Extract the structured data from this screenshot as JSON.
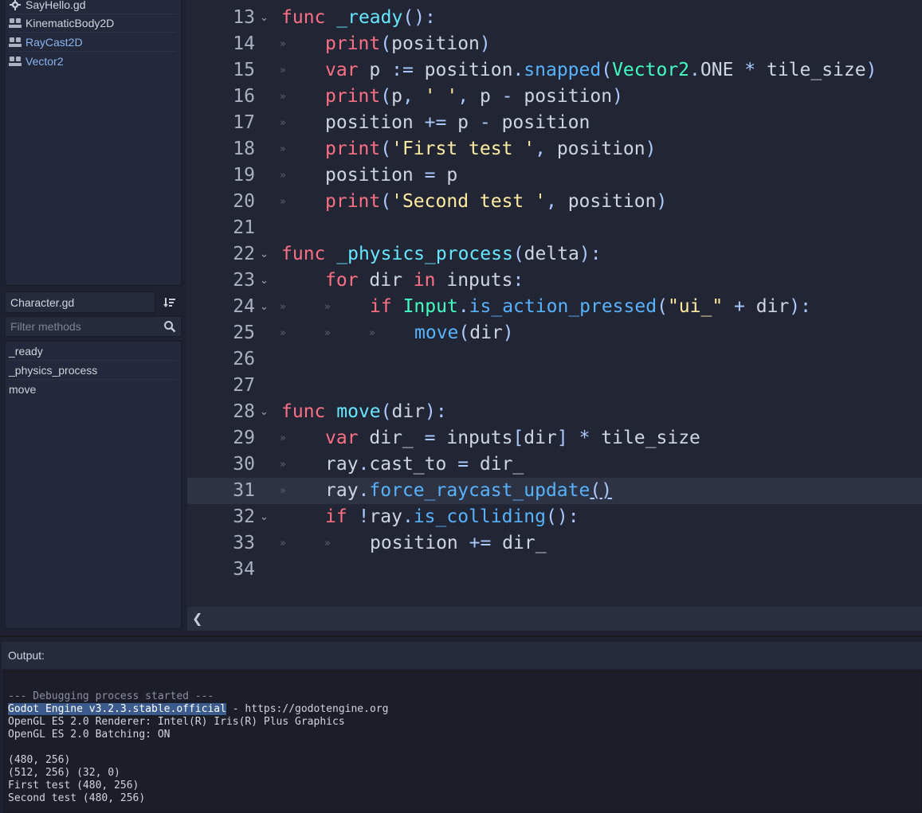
{
  "scripts_panel": {
    "items": [
      {
        "label": "SayHello.gd",
        "icon": "gear-icon"
      },
      {
        "label": "KinematicBody2D",
        "icon": "doc-icon"
      },
      {
        "label": "RayCast2D",
        "icon": "doc-icon"
      },
      {
        "label": "Vector2",
        "icon": "doc-icon"
      }
    ]
  },
  "methods_panel": {
    "file_name": "Character.gd",
    "filter_placeholder": "Filter methods",
    "methods": [
      "_ready",
      "_physics_process",
      "move"
    ]
  },
  "editor": {
    "lines": [
      {
        "n": "13",
        "fold": true,
        "indent": 0
      },
      {
        "n": "14",
        "fold": false,
        "indent": 1
      },
      {
        "n": "15",
        "fold": false,
        "indent": 1
      },
      {
        "n": "16",
        "fold": false,
        "indent": 1
      },
      {
        "n": "17",
        "fold": false,
        "indent": 1
      },
      {
        "n": "18",
        "fold": false,
        "indent": 1
      },
      {
        "n": "19",
        "fold": false,
        "indent": 1
      },
      {
        "n": "20",
        "fold": false,
        "indent": 1
      },
      {
        "n": "21",
        "fold": false,
        "indent": 0
      },
      {
        "n": "22",
        "fold": true,
        "indent": 0
      },
      {
        "n": "23",
        "fold": true,
        "indent": 0
      },
      {
        "n": "24",
        "fold": true,
        "indent": 1
      },
      {
        "n": "25",
        "fold": false,
        "indent": 2
      },
      {
        "n": "26",
        "fold": false,
        "indent": 0
      },
      {
        "n": "27",
        "fold": false,
        "indent": 0
      },
      {
        "n": "28",
        "fold": true,
        "indent": 0
      },
      {
        "n": "29",
        "fold": false,
        "indent": 1
      },
      {
        "n": "30",
        "fold": false,
        "indent": 1
      },
      {
        "n": "31",
        "fold": false,
        "indent": 1,
        "current": true
      },
      {
        "n": "32",
        "fold": true,
        "indent": 0
      },
      {
        "n": "33",
        "fold": false,
        "indent": 1
      },
      {
        "n": "34",
        "fold": false,
        "indent": 0
      }
    ]
  },
  "output": {
    "title": "Output:",
    "log": [
      "--- Debugging process started ---",
      "Godot Engine v3.2.3.stable.official",
      " - https://godotengine.org",
      "OpenGL ES 2.0 Renderer: Intel(R) Iris(R) Plus Graphics",
      "OpenGL ES 2.0 Batching: ON",
      "",
      "(480, 256)",
      "(512, 256) (32, 0)",
      "First test (480, 256)",
      "Second test (480, 256)"
    ]
  },
  "colors": {
    "keyword": "#ff7085",
    "function": "#57b3ff",
    "class": "#42ffc2",
    "string": "#ffeca1",
    "background": "#222634"
  }
}
